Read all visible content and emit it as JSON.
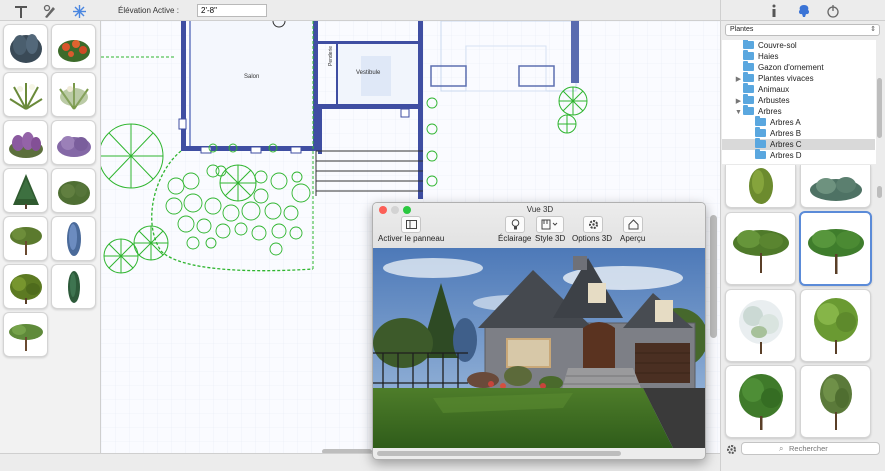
{
  "toolbar": {
    "elevation_label": "Élévation Active :",
    "elevation_value": "2'-8\""
  },
  "plan": {
    "room_living": "Salon",
    "room_vestibule": "Vestibule",
    "room_penderie": "Penderie"
  },
  "library": {
    "dropdown_value": "Plantes",
    "tree_items": [
      {
        "label": "Couvre-sol",
        "expanded": false
      },
      {
        "label": "Haies",
        "expanded": false
      },
      {
        "label": "Gazon d'ornement",
        "expanded": false
      },
      {
        "label": "Plantes vivaces",
        "expanded": false
      },
      {
        "label": "Animaux",
        "expanded": false
      },
      {
        "label": "Arbustes",
        "expanded": false
      },
      {
        "label": "Arbres",
        "expanded": true
      },
      {
        "label": "Arbres A",
        "expanded": false
      },
      {
        "label": "Arbres B",
        "expanded": false
      },
      {
        "label": "Arbres C",
        "selected": true
      },
      {
        "label": "Arbres D",
        "expanded": false
      }
    ],
    "search_placeholder": "Rechercher"
  },
  "view3d": {
    "title": "Vue 3D",
    "activate_panel_label": "Activer le panneau",
    "lighting_label": "Éclairage",
    "style_label": "Style 3D",
    "options_label": "Options 3D",
    "preview_label": "Aperçu"
  },
  "colors": {
    "accent": "#5b8bd8",
    "folder": "#5aa7df",
    "plant_green": "#2fb52f",
    "wall": "#3f4ea2"
  }
}
